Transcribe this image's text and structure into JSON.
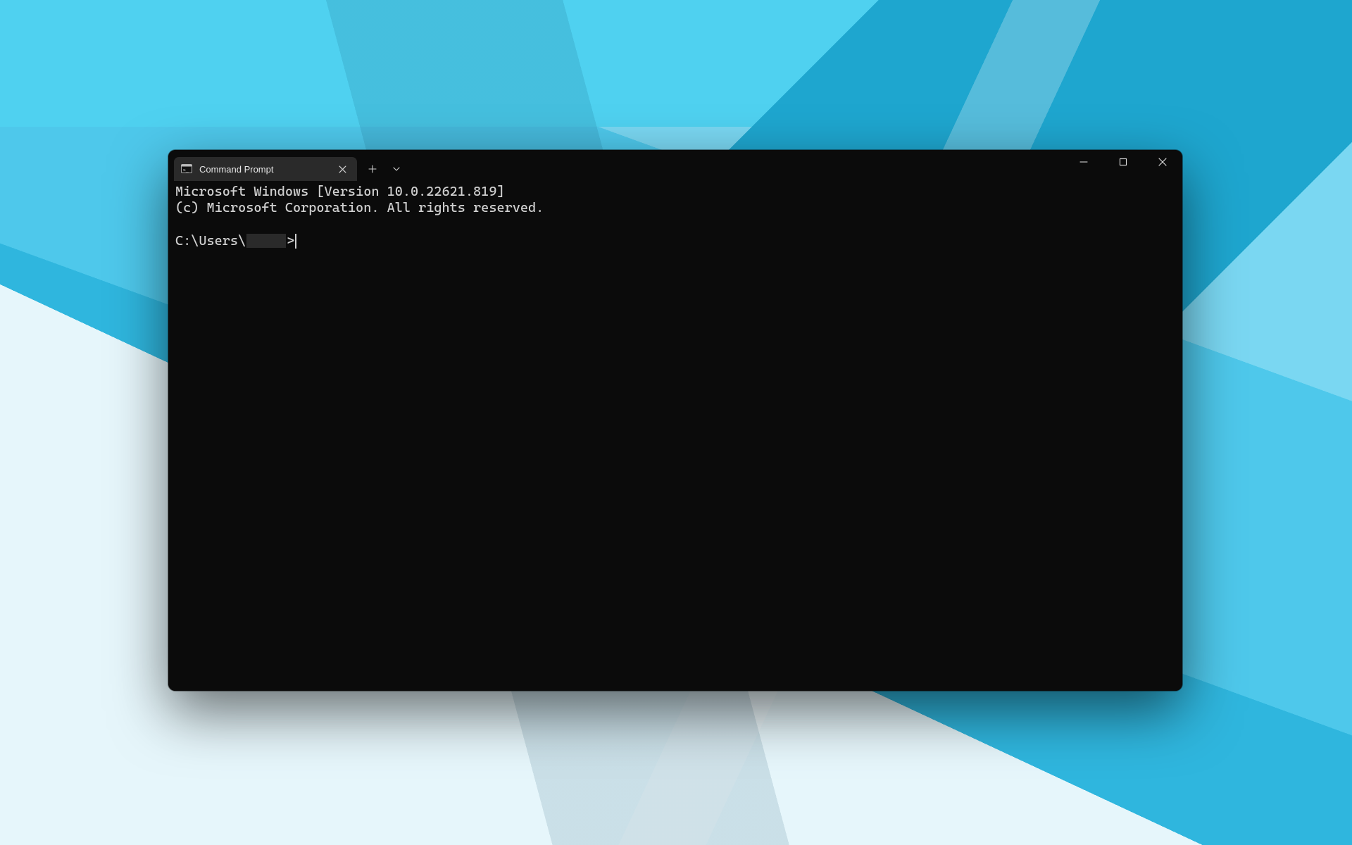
{
  "tab": {
    "title": "Command Prompt"
  },
  "terminal": {
    "line1": "Microsoft Windows [Version 10.0.22621.819]",
    "line2": "(c) Microsoft Corporation. All rights reserved.",
    "prompt_prefix": "C:\\Users\\",
    "prompt_suffix": ">"
  }
}
